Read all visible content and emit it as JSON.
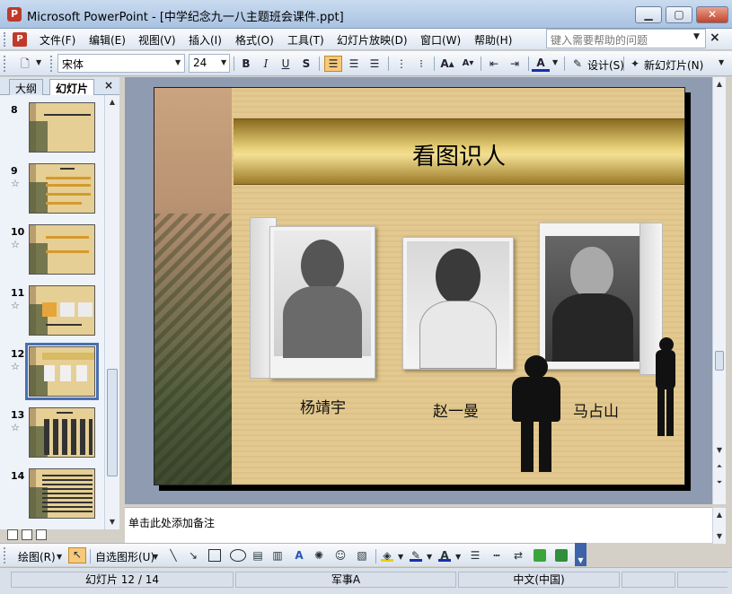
{
  "window": {
    "title": "Microsoft PowerPoint - [中学纪念九一八主题班会课件.ppt]",
    "minimize_icon": "minimize-icon",
    "maximize_icon": "maximize-icon",
    "close_icon": "close-icon"
  },
  "menubar": {
    "items": [
      "文件(F)",
      "编辑(E)",
      "视图(V)",
      "插入(I)",
      "格式(O)",
      "工具(T)",
      "幻灯片放映(D)",
      "窗口(W)",
      "帮助(H)"
    ],
    "help_placeholder": "键入需要帮助的问题"
  },
  "toolbar": {
    "font_name": "宋体",
    "font_size": "24",
    "bold": "B",
    "italic": "I",
    "underline": "U",
    "shadow": "S",
    "design_label": "设计(S)",
    "new_slide_label": "新幻灯片(N)"
  },
  "left_panel": {
    "tab_outline": "大纲",
    "tab_slides": "幻灯片",
    "close": "×",
    "slides": [
      {
        "num": "8",
        "star": ""
      },
      {
        "num": "9",
        "star": "☆"
      },
      {
        "num": "10",
        "star": "☆"
      },
      {
        "num": "11",
        "star": "☆"
      },
      {
        "num": "12",
        "star": "☆"
      },
      {
        "num": "13",
        "star": "☆"
      },
      {
        "num": "14",
        "star": ""
      }
    ],
    "selected_index": 4
  },
  "slide": {
    "title": "看图识人",
    "captions": [
      "杨靖宇",
      "赵一曼",
      "马占山"
    ]
  },
  "notes": {
    "placeholder": "单击此处添加备注"
  },
  "drawbar": {
    "draw_label": "绘图(R)",
    "autoshape_label": "自选图形(U)"
  },
  "status": {
    "slide_info": "幻灯片 12 / 14",
    "design": "军事A",
    "language": "中文(中国)"
  },
  "colors": {
    "slide_bg": "#e3c98f",
    "banner": "#e9d27a",
    "selection": "#4a6fb0"
  }
}
